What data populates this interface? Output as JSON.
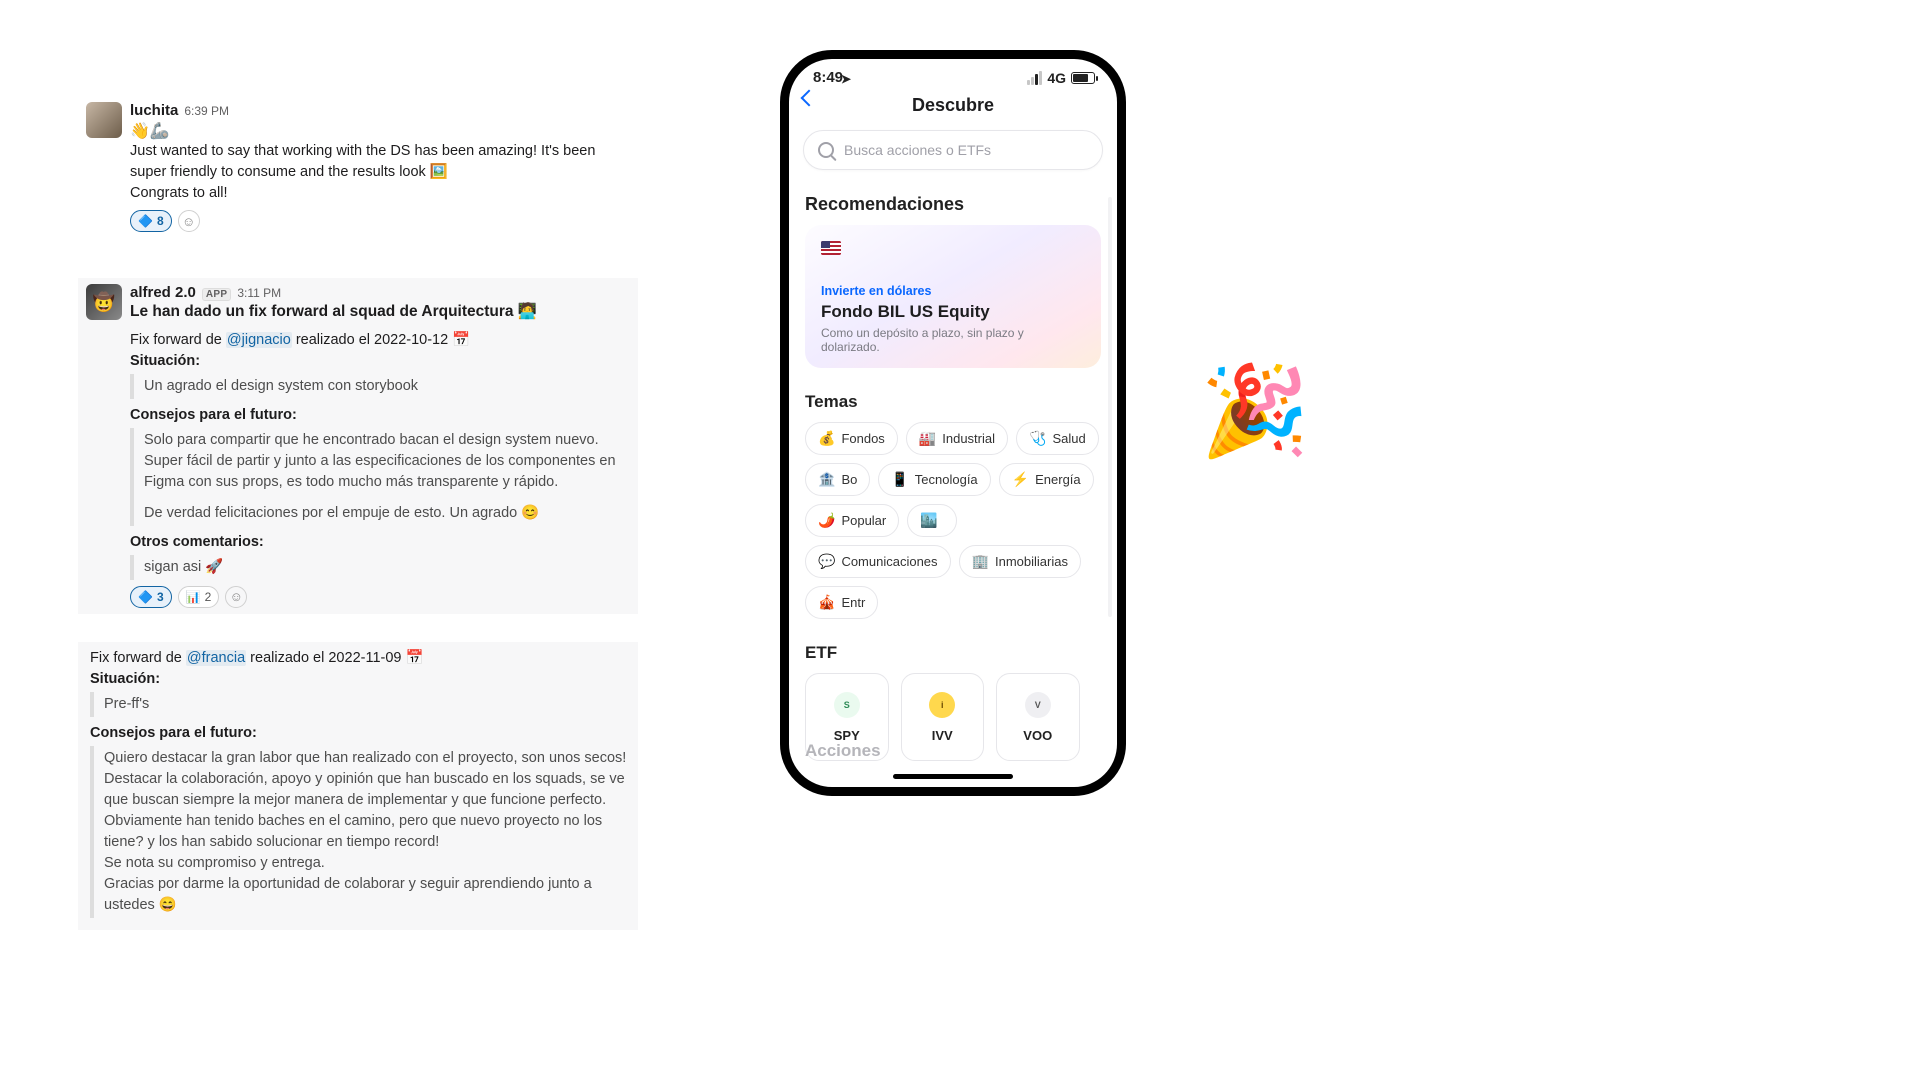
{
  "slack": {
    "msg1": {
      "author": "luchita",
      "time": "6:39 PM",
      "line1": "Just wanted to say that working with the DS has been amazing! It's been super friendly to consume and the results look 🖼️",
      "line2": "Congrats to all!",
      "react1_icon": "🔷",
      "react1_count": "8"
    },
    "msg2": {
      "author": "alfred 2.0",
      "badge": "APP",
      "time": "3:11 PM",
      "title": "Le han dado un fix forward al squad de Arquitectura 🧑‍💻",
      "ff_prefix": "Fix forward de ",
      "mention": "@jignacio",
      "ff_suffix": " realizado el 2022-10-12 📅",
      "h1": "Situación:",
      "q1": "Un agrado el design system con storybook",
      "h2": "Consejos para el futuro:",
      "q2a": "Solo para compartir que he encontrado bacan el design system nuevo. Super fácil de partir y junto a las especificaciones de los componentes en Figma con sus props, es todo mucho más transparente y rápido.",
      "q2b": "De verdad felicitaciones por el empuje de esto. Un agrado 😊",
      "h3": "Otros comentarios:",
      "q3": "sigan asi 🚀",
      "r1_icon": "🔷",
      "r1_count": "3",
      "r2_icon": "📊",
      "r2_count": "2"
    },
    "msg3": {
      "ff_prefix": "Fix forward de ",
      "mention": "@francia",
      "ff_suffix": " realizado el 2022-11-09 📅",
      "h1": "Situación:",
      "q1": "Pre-ff's",
      "h2": "Consejos para el futuro:",
      "q2": "Quiero destacar la gran labor que han realizado con el proyecto, son unos secos! Destacar la colaboración, apoyo y opinión que han buscado en los squads, se ve que buscan siempre la mejor manera de implementar y que funcione perfecto. Obviamente han tenido baches en el camino, pero que nuevo proyecto no los tiene? y los han sabido solucionar en tiempo record!",
      "q2b": "Se nota su compromiso y entrega.",
      "q2c": "Gracias por darme la oportunidad de colaborar y seguir aprendiendo junto a ustedes 😄"
    }
  },
  "phone": {
    "status_time": "8:49",
    "network": "4G",
    "title": "Descubre",
    "search_placeholder": "Busca acciones o ETFs",
    "section_reco": "Recomendaciones",
    "reco_sub": "Invierte en dólares",
    "reco_title": "Fondo BIL US Equity",
    "reco_desc": "Como un depósito a plazo, sin plazo y dolarizado.",
    "section_temas": "Temas",
    "chips": [
      {
        "icon": "💰",
        "label": "Fondos"
      },
      {
        "icon": "🏭",
        "label": "Industrial"
      },
      {
        "icon": "🩺",
        "label": "Salud"
      },
      {
        "icon": "🏦",
        "label": "Bo"
      },
      {
        "icon": "📱",
        "label": "Tecnología"
      },
      {
        "icon": "⚡",
        "label": "Energía"
      },
      {
        "icon": "🌶️",
        "label": "Popular"
      },
      {
        "icon": "🏙️",
        "label": ""
      },
      {
        "icon": "💬",
        "label": "Comunicaciones"
      },
      {
        "icon": "🏢",
        "label": "Inmobiliarias"
      },
      {
        "icon": "🎪",
        "label": "Entr"
      }
    ],
    "section_etf": "ETF",
    "etfs": [
      {
        "ticker": "SPY",
        "logo": "SPDR",
        "cls": "etf-spy"
      },
      {
        "ticker": "IVV",
        "logo": "iShares",
        "cls": "etf-ivv"
      },
      {
        "ticker": "VOO",
        "logo": "V",
        "cls": "etf-voo"
      }
    ],
    "section_peek": "Acciones"
  },
  "party_emoji": "🎉"
}
